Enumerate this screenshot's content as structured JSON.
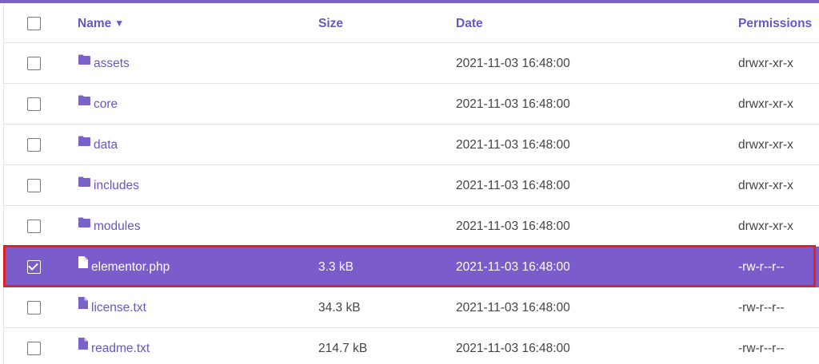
{
  "header": {
    "name": "Name",
    "sort_indicator": "▼",
    "size": "Size",
    "date": "Date",
    "permissions": "Permissions"
  },
  "files": [
    {
      "name": "assets",
      "type": "folder",
      "size": "",
      "date": "2021-11-03 16:48:00",
      "permissions": "drwxr-xr-x",
      "checked": false
    },
    {
      "name": "core",
      "type": "folder",
      "size": "",
      "date": "2021-11-03 16:48:00",
      "permissions": "drwxr-xr-x",
      "checked": false
    },
    {
      "name": "data",
      "type": "folder",
      "size": "",
      "date": "2021-11-03 16:48:00",
      "permissions": "drwxr-xr-x",
      "checked": false
    },
    {
      "name": "includes",
      "type": "folder",
      "size": "",
      "date": "2021-11-03 16:48:00",
      "permissions": "drwxr-xr-x",
      "checked": false
    },
    {
      "name": "modules",
      "type": "folder",
      "size": "",
      "date": "2021-11-03 16:48:00",
      "permissions": "drwxr-xr-x",
      "checked": false
    },
    {
      "name": "elementor.php",
      "type": "file",
      "size": "3.3 kB",
      "date": "2021-11-03 16:48:00",
      "permissions": "-rw-r--r--",
      "checked": true
    },
    {
      "name": "license.txt",
      "type": "file",
      "size": "34.3 kB",
      "date": "2021-11-03 16:48:00",
      "permissions": "-rw-r--r--",
      "checked": false
    },
    {
      "name": "readme.txt",
      "type": "file",
      "size": "214.7 kB",
      "date": "2021-11-03 16:48:00",
      "permissions": "-rw-r--r--",
      "checked": false
    }
  ],
  "icons": {
    "folder": "folder-icon",
    "file": "file-icon"
  },
  "colors": {
    "accent": "#7a5ccb",
    "link": "#6a55c4",
    "highlight_border": "#e02027"
  }
}
